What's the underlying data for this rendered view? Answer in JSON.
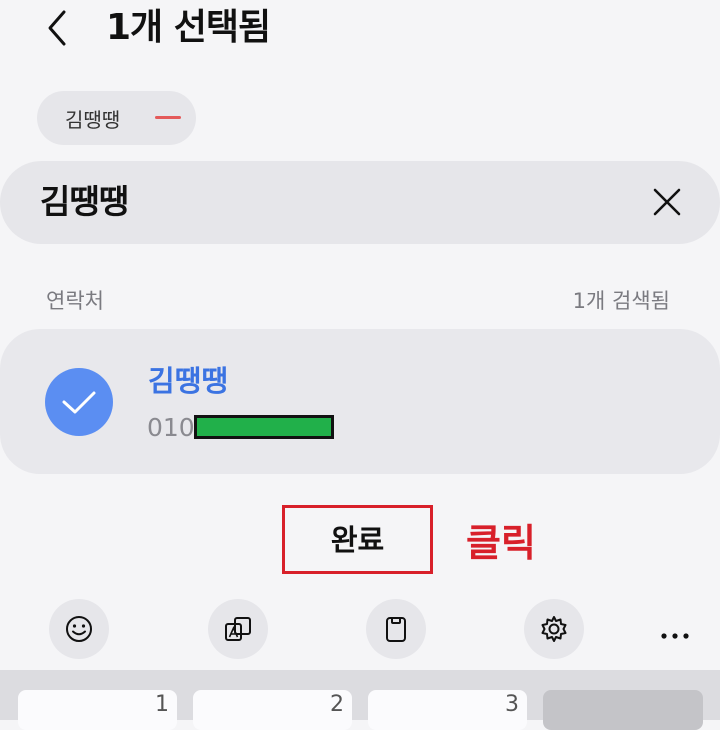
{
  "header": {
    "title": "1개 선택됨"
  },
  "selected_chips": [
    {
      "label": "김땡땡"
    }
  ],
  "search": {
    "query": "김땡땡"
  },
  "results": {
    "section_label": "연락처",
    "count_label": "1개 검색됨"
  },
  "contact": {
    "name": "김땡땡",
    "phone_prefix": "010"
  },
  "done_button": {
    "label": "완료"
  },
  "annotation": {
    "text": "클릭"
  },
  "toolbar": {
    "items": [
      "emoji-icon",
      "translate-icon",
      "clipboard-icon",
      "settings-icon",
      "more-icon"
    ]
  },
  "keyboard": {
    "keys": [
      "1",
      "2",
      "3"
    ]
  },
  "colors": {
    "accent": "#3b73e2",
    "avatar": "#5b8ef2",
    "annotation": "#d8202a",
    "redaction": "#21b04a",
    "chip_remove": "#e45a5a"
  }
}
